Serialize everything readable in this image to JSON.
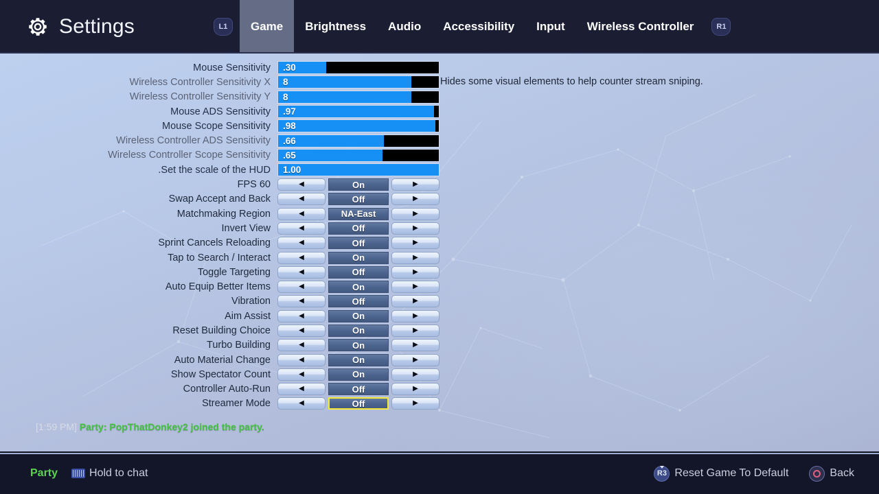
{
  "header": {
    "gear_icon": "gear-icon",
    "title": "Settings",
    "left_bumper": "L1",
    "right_bumper": "R1",
    "tabs": [
      {
        "label": "Game",
        "active": true
      },
      {
        "label": "Brightness",
        "active": false
      },
      {
        "label": "Audio",
        "active": false
      },
      {
        "label": "Accessibility",
        "active": false
      },
      {
        "label": "Input",
        "active": false
      },
      {
        "label": "Wireless Controller",
        "active": false
      }
    ]
  },
  "settings": {
    "sliders": [
      {
        "label": "Mouse Sensitivity",
        "value": ".30",
        "percent": 30,
        "dim": false
      },
      {
        "label": "Wireless Controller Sensitivity X",
        "value": "8",
        "percent": 83,
        "dim": true
      },
      {
        "label": "Wireless Controller Sensitivity Y",
        "value": "8",
        "percent": 83,
        "dim": true
      },
      {
        "label": "Mouse ADS Sensitivity",
        "value": ".97",
        "percent": 97,
        "dim": false
      },
      {
        "label": "Mouse Scope Sensitivity",
        "value": ".98",
        "percent": 98,
        "dim": false
      },
      {
        "label": "Wireless Controller ADS Sensitivity",
        "value": ".66",
        "percent": 66,
        "dim": true
      },
      {
        "label": "Wireless Controller Scope Sensitivity",
        "value": ".65",
        "percent": 65,
        "dim": true
      },
      {
        "label": "Set the scale of the HUD.",
        "value": "1.00",
        "percent": 100,
        "dim": false
      }
    ],
    "toggles": [
      {
        "label": "60 FPS",
        "value": "On",
        "selected": false
      },
      {
        "label": "Swap Accept and Back",
        "value": "Off",
        "selected": false
      },
      {
        "label": "Matchmaking Region",
        "value": "NA-East",
        "selected": false
      },
      {
        "label": "Invert View",
        "value": "Off",
        "selected": false
      },
      {
        "label": "Sprint Cancels Reloading",
        "value": "Off",
        "selected": false
      },
      {
        "label": "Tap to Search / Interact",
        "value": "On",
        "selected": false
      },
      {
        "label": "Toggle Targeting",
        "value": "Off",
        "selected": false
      },
      {
        "label": "Auto Equip Better Items",
        "value": "On",
        "selected": false
      },
      {
        "label": "Vibration",
        "value": "Off",
        "selected": false
      },
      {
        "label": "Aim Assist",
        "value": "On",
        "selected": false
      },
      {
        "label": "Reset Building Choice",
        "value": "On",
        "selected": false
      },
      {
        "label": "Turbo Building",
        "value": "On",
        "selected": false
      },
      {
        "label": "Auto Material Change",
        "value": "On",
        "selected": false
      },
      {
        "label": "Show Spectator Count",
        "value": "On",
        "selected": false
      },
      {
        "label": "Controller Auto-Run",
        "value": "Off",
        "selected": false
      },
      {
        "label": "Streamer Mode",
        "value": "Off",
        "selected": true
      }
    ],
    "left_arrow": "◀",
    "right_arrow": "▶"
  },
  "description": {
    "text": "Hides some visual elements to help counter stream sniping."
  },
  "chat": {
    "timestamp": "[1:59 PM]",
    "message": "Party: PopThatDonkey2 joined the party."
  },
  "bottom_bar": {
    "party_label": "Party",
    "hold_to_chat": "Hold to chat",
    "reset_button": "Reset Game To Default",
    "reset_button_icon": "R3",
    "back_button": "Back"
  },
  "colors": {
    "accent_blue": "#1790f5",
    "selection_yellow": "#f5e63a",
    "party_green": "#5fd152",
    "chat_green": "#43c23f",
    "topbar": "#1b1e33"
  }
}
